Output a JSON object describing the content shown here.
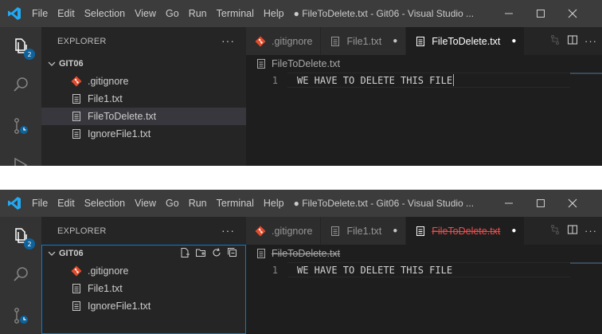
{
  "menu": [
    "File",
    "Edit",
    "Selection",
    "View",
    "Go",
    "Run",
    "Terminal",
    "Help"
  ],
  "colors": {
    "titlebar": "#3c3c3c",
    "activitybar": "#333333",
    "sidebar": "#252526",
    "editor": "#1e1e1e",
    "badge": "#0e639c",
    "focus_border": "#007fd4",
    "git_icon": "#e44b2a",
    "deleted_text": "#f14c4c"
  },
  "screen1": {
    "window_title": "● FileToDelete.txt - Git06 - Visual Studio ...",
    "badge_count": "2",
    "sidebar": {
      "header": "EXPLORER",
      "more": "···",
      "section": "GIT06",
      "files": [
        {
          "name": ".gitignore",
          "icon": "git-icon"
        },
        {
          "name": "File1.txt",
          "icon": "file-icon"
        },
        {
          "name": "FileToDelete.txt",
          "icon": "file-icon",
          "selected": true
        },
        {
          "name": "IgnoreFile1.txt",
          "icon": "file-icon"
        }
      ]
    },
    "tabs": [
      {
        "label": ".gitignore",
        "icon": "git-icon",
        "dirty": false
      },
      {
        "label": "File1.txt",
        "icon": "file-icon",
        "dirty": true
      },
      {
        "label": "FileToDelete.txt",
        "icon": "file-icon",
        "dirty": true,
        "active": true
      }
    ],
    "breadcrumb": "FileToDelete.txt",
    "code": [
      {
        "line": "1",
        "text": "WE HAVE TO DELETE THIS FILE"
      }
    ]
  },
  "screen2": {
    "window_title": "● FileToDelete.txt - Git06 - Visual Studio ...",
    "badge_count": "2",
    "sidebar": {
      "header": "EXPLORER",
      "more": "···",
      "section": "GIT06",
      "files": [
        {
          "name": ".gitignore",
          "icon": "git-icon"
        },
        {
          "name": "File1.txt",
          "icon": "file-icon"
        },
        {
          "name": "IgnoreFile1.txt",
          "icon": "file-icon"
        }
      ]
    },
    "tabs": [
      {
        "label": ".gitignore",
        "icon": "git-icon",
        "dirty": false
      },
      {
        "label": "File1.txt",
        "icon": "file-icon",
        "dirty": true
      },
      {
        "label": "FileToDelete.txt",
        "icon": "file-icon",
        "dirty": true,
        "active": true,
        "deleted": true
      }
    ],
    "breadcrumb": "FileToDelete.txt",
    "code": [
      {
        "line": "1",
        "text": "WE HAVE TO DELETE THIS FILE"
      }
    ]
  }
}
